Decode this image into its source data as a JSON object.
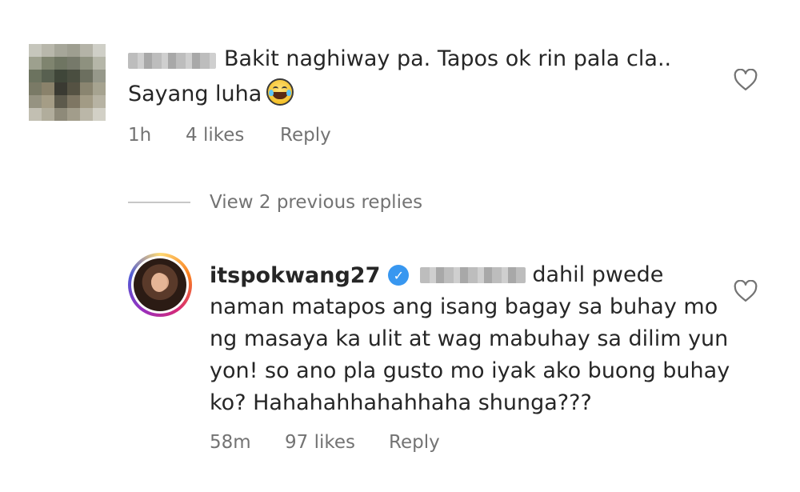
{
  "comment": {
    "text_line1": "Bakit naghiway pa. Tapos ok rin pala cla..",
    "text_line2": "Sayang luha",
    "time": "1h",
    "likes": "4 likes",
    "reply_label": "Reply"
  },
  "view_replies": "View 2 previous replies",
  "reply": {
    "username": "itspokwang27",
    "line1_tail": "dahil pwede",
    "line2": "naman matapos ang isang bagay sa buhay mo",
    "line3": "ng masaya ka ulit at wag mabuhay sa dilim yun",
    "line4": "yon! so ano pla gusto mo iyak ako buong buhay",
    "line5": "ko? Hahahahhahahhaha shunga???",
    "time": "58m",
    "likes": "97 likes",
    "reply_label": "Reply"
  },
  "icons": {
    "like": "heart-outline-icon",
    "verified": "verified-badge-icon",
    "emoji": "tears-of-joy-emoji"
  },
  "colors": {
    "text": "#262626",
    "meta": "#737373",
    "verified": "#3897f0"
  }
}
